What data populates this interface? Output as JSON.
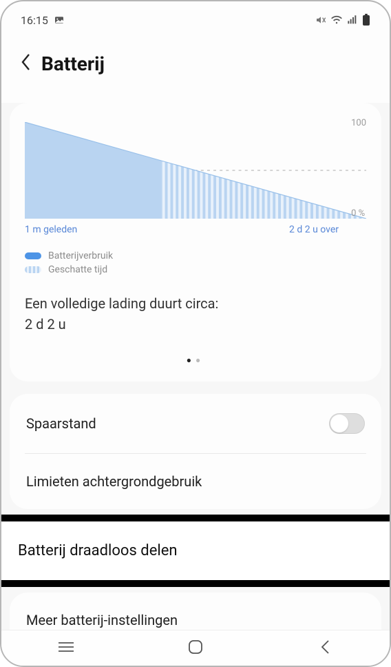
{
  "status": {
    "time": "16:15"
  },
  "header": {
    "title": "Batterij"
  },
  "chart_data": {
    "type": "area",
    "ylim": [
      0,
      100
    ],
    "start_pct": 100,
    "end_pct": 0,
    "x_start_label": "1 m geleden",
    "x_end_label": "2 d 2 u over",
    "y_top_label": "100",
    "y_bottom_label": "0 %",
    "midline_pct": 50,
    "usage_fraction": 0.4,
    "series": [
      {
        "name": "Batterijverbruik",
        "style": "solid"
      },
      {
        "name": "Geschatte tijd",
        "style": "striped"
      }
    ]
  },
  "duration": {
    "label": "Een volledige lading duurt circa:",
    "value": "2 d 2 u"
  },
  "rows": {
    "powersave": "Spaarstand",
    "background_limits": "Limieten achtergrondgebruik",
    "wireless_share": "Batterij draadloos delen",
    "more_settings": "Meer batterij-instellingen"
  }
}
